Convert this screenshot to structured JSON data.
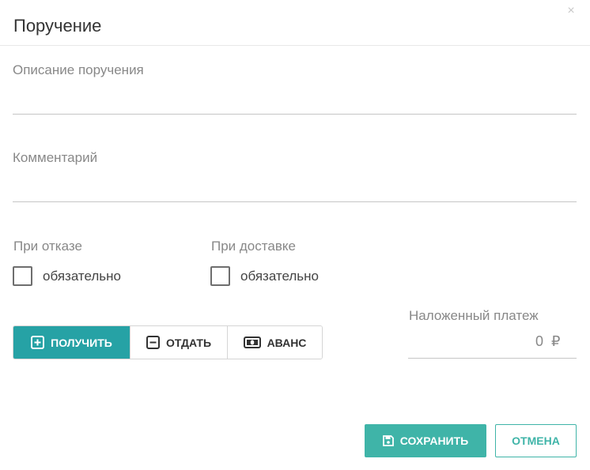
{
  "dialog": {
    "title": "Поручение",
    "close_symbol": "×"
  },
  "fields": {
    "description": {
      "label": "Описание поручения",
      "value": ""
    },
    "comment": {
      "label": "Комментарий",
      "value": ""
    }
  },
  "options": {
    "on_refusal": {
      "label": "При отказе",
      "checkbox_label": "обязательно",
      "checked": false
    },
    "on_delivery": {
      "label": "При доставке",
      "checkbox_label": "обязательно",
      "checked": false
    }
  },
  "payment_mode": {
    "selected": "receive",
    "buttons": [
      {
        "id": "receive",
        "label": "ПОЛУЧИТЬ",
        "icon": "plus-square-icon"
      },
      {
        "id": "give",
        "label": "ОТДАТЬ",
        "icon": "minus-square-icon"
      },
      {
        "id": "advance",
        "label": "АВАНС",
        "icon": "money-icon"
      }
    ]
  },
  "cash_on_delivery": {
    "label": "Наложенный платеж",
    "value": "0",
    "currency": "₽"
  },
  "actions": {
    "save_label": "СОХРАНИТЬ",
    "save_icon": "floppy-icon",
    "cancel_label": "ОТМЕНА"
  },
  "colors": {
    "accent": "#26a2a5",
    "save": "#3fb4a8"
  }
}
